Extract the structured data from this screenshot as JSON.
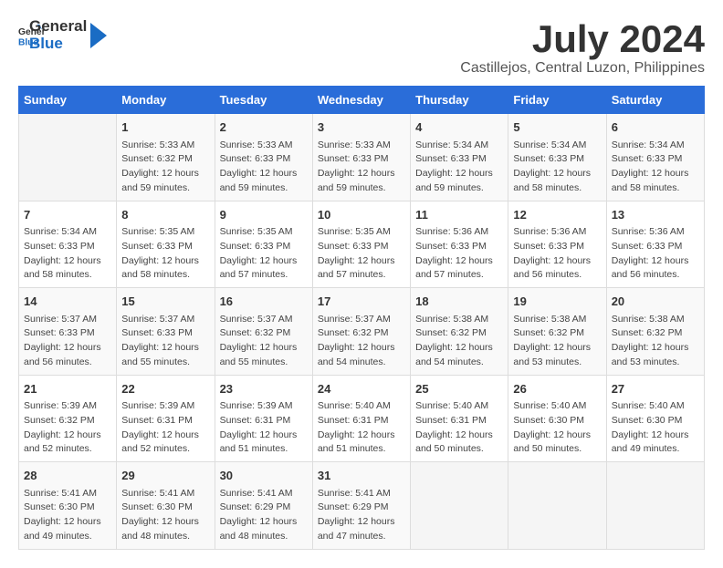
{
  "header": {
    "logo_general": "General",
    "logo_blue": "Blue",
    "title": "July 2024",
    "subtitle": "Castillejos, Central Luzon, Philippines"
  },
  "calendar": {
    "days_of_week": [
      "Sunday",
      "Monday",
      "Tuesday",
      "Wednesday",
      "Thursday",
      "Friday",
      "Saturday"
    ],
    "weeks": [
      [
        {
          "day": "",
          "info": ""
        },
        {
          "day": "1",
          "info": "Sunrise: 5:33 AM\nSunset: 6:32 PM\nDaylight: 12 hours\nand 59 minutes."
        },
        {
          "day": "2",
          "info": "Sunrise: 5:33 AM\nSunset: 6:33 PM\nDaylight: 12 hours\nand 59 minutes."
        },
        {
          "day": "3",
          "info": "Sunrise: 5:33 AM\nSunset: 6:33 PM\nDaylight: 12 hours\nand 59 minutes."
        },
        {
          "day": "4",
          "info": "Sunrise: 5:34 AM\nSunset: 6:33 PM\nDaylight: 12 hours\nand 59 minutes."
        },
        {
          "day": "5",
          "info": "Sunrise: 5:34 AM\nSunset: 6:33 PM\nDaylight: 12 hours\nand 58 minutes."
        },
        {
          "day": "6",
          "info": "Sunrise: 5:34 AM\nSunset: 6:33 PM\nDaylight: 12 hours\nand 58 minutes."
        }
      ],
      [
        {
          "day": "7",
          "info": "Sunrise: 5:34 AM\nSunset: 6:33 PM\nDaylight: 12 hours\nand 58 minutes."
        },
        {
          "day": "8",
          "info": "Sunrise: 5:35 AM\nSunset: 6:33 PM\nDaylight: 12 hours\nand 58 minutes."
        },
        {
          "day": "9",
          "info": "Sunrise: 5:35 AM\nSunset: 6:33 PM\nDaylight: 12 hours\nand 57 minutes."
        },
        {
          "day": "10",
          "info": "Sunrise: 5:35 AM\nSunset: 6:33 PM\nDaylight: 12 hours\nand 57 minutes."
        },
        {
          "day": "11",
          "info": "Sunrise: 5:36 AM\nSunset: 6:33 PM\nDaylight: 12 hours\nand 57 minutes."
        },
        {
          "day": "12",
          "info": "Sunrise: 5:36 AM\nSunset: 6:33 PM\nDaylight: 12 hours\nand 56 minutes."
        },
        {
          "day": "13",
          "info": "Sunrise: 5:36 AM\nSunset: 6:33 PM\nDaylight: 12 hours\nand 56 minutes."
        }
      ],
      [
        {
          "day": "14",
          "info": "Sunrise: 5:37 AM\nSunset: 6:33 PM\nDaylight: 12 hours\nand 56 minutes."
        },
        {
          "day": "15",
          "info": "Sunrise: 5:37 AM\nSunset: 6:33 PM\nDaylight: 12 hours\nand 55 minutes."
        },
        {
          "day": "16",
          "info": "Sunrise: 5:37 AM\nSunset: 6:32 PM\nDaylight: 12 hours\nand 55 minutes."
        },
        {
          "day": "17",
          "info": "Sunrise: 5:37 AM\nSunset: 6:32 PM\nDaylight: 12 hours\nand 54 minutes."
        },
        {
          "day": "18",
          "info": "Sunrise: 5:38 AM\nSunset: 6:32 PM\nDaylight: 12 hours\nand 54 minutes."
        },
        {
          "day": "19",
          "info": "Sunrise: 5:38 AM\nSunset: 6:32 PM\nDaylight: 12 hours\nand 53 minutes."
        },
        {
          "day": "20",
          "info": "Sunrise: 5:38 AM\nSunset: 6:32 PM\nDaylight: 12 hours\nand 53 minutes."
        }
      ],
      [
        {
          "day": "21",
          "info": "Sunrise: 5:39 AM\nSunset: 6:32 PM\nDaylight: 12 hours\nand 52 minutes."
        },
        {
          "day": "22",
          "info": "Sunrise: 5:39 AM\nSunset: 6:31 PM\nDaylight: 12 hours\nand 52 minutes."
        },
        {
          "day": "23",
          "info": "Sunrise: 5:39 AM\nSunset: 6:31 PM\nDaylight: 12 hours\nand 51 minutes."
        },
        {
          "day": "24",
          "info": "Sunrise: 5:40 AM\nSunset: 6:31 PM\nDaylight: 12 hours\nand 51 minutes."
        },
        {
          "day": "25",
          "info": "Sunrise: 5:40 AM\nSunset: 6:31 PM\nDaylight: 12 hours\nand 50 minutes."
        },
        {
          "day": "26",
          "info": "Sunrise: 5:40 AM\nSunset: 6:30 PM\nDaylight: 12 hours\nand 50 minutes."
        },
        {
          "day": "27",
          "info": "Sunrise: 5:40 AM\nSunset: 6:30 PM\nDaylight: 12 hours\nand 49 minutes."
        }
      ],
      [
        {
          "day": "28",
          "info": "Sunrise: 5:41 AM\nSunset: 6:30 PM\nDaylight: 12 hours\nand 49 minutes."
        },
        {
          "day": "29",
          "info": "Sunrise: 5:41 AM\nSunset: 6:30 PM\nDaylight: 12 hours\nand 48 minutes."
        },
        {
          "day": "30",
          "info": "Sunrise: 5:41 AM\nSunset: 6:29 PM\nDaylight: 12 hours\nand 48 minutes."
        },
        {
          "day": "31",
          "info": "Sunrise: 5:41 AM\nSunset: 6:29 PM\nDaylight: 12 hours\nand 47 minutes."
        },
        {
          "day": "",
          "info": ""
        },
        {
          "day": "",
          "info": ""
        },
        {
          "day": "",
          "info": ""
        }
      ]
    ]
  }
}
